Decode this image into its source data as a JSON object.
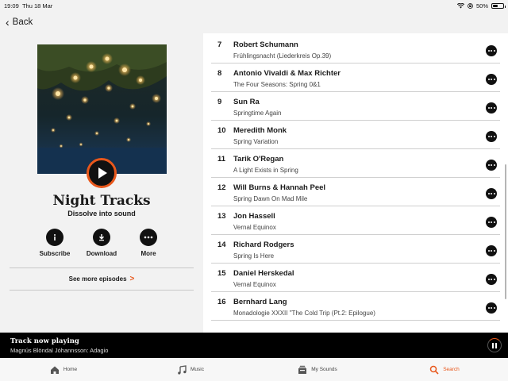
{
  "status_bar": {
    "time": "19:09",
    "date": "Thu 18 Mar",
    "battery": "50%",
    "battery_level": 0.5
  },
  "nav": {
    "back_label": "Back"
  },
  "show": {
    "title": "Night Tracks",
    "subtitle": "Dissolve into sound",
    "actions": [
      {
        "label": "Subscribe",
        "icon": "info-icon"
      },
      {
        "label": "Download",
        "icon": "download-icon"
      },
      {
        "label": "More",
        "icon": "more-icon"
      }
    ],
    "see_more": "See more episodes"
  },
  "tracks": [
    {
      "num": "7",
      "artist": "Robert Schumann",
      "title": "Frühlingsnacht (Liederkreis Op.39)"
    },
    {
      "num": "8",
      "artist": "Antonio Vivaldi & Max Richter",
      "title": "The Four Seasons: Spring 0&1"
    },
    {
      "num": "9",
      "artist": "Sun Ra",
      "title": "Springtime Again"
    },
    {
      "num": "10",
      "artist": "Meredith Monk",
      "title": "Spring Variation"
    },
    {
      "num": "11",
      "artist": "Tarik O'Regan",
      "title": "A Light Exists in Spring"
    },
    {
      "num": "12",
      "artist": "Will Burns & Hannah Peel",
      "title": "Spring Dawn On Mad Mile"
    },
    {
      "num": "13",
      "artist": "Jon Hassell",
      "title": "Vernal Equinox"
    },
    {
      "num": "14",
      "artist": "Richard Rodgers",
      "title": "Spring Is Here"
    },
    {
      "num": "15",
      "artist": "Daniel Herskedal",
      "title": "Vernal Equinox"
    },
    {
      "num": "16",
      "artist": "Bernhard Lang",
      "title": "Monadologie XXXII \"The Cold Trip (Pt.2: Epilogue)"
    }
  ],
  "now_playing": {
    "label": "Track now playing",
    "track": "Magnús Blöndal Jóhannsson: Adagio"
  },
  "tabs": [
    {
      "label": "Home",
      "icon": "home-icon",
      "active": false
    },
    {
      "label": "Music",
      "icon": "music-note-icon",
      "active": false
    },
    {
      "label": "My Sounds",
      "icon": "my-sounds-icon",
      "active": false
    },
    {
      "label": "Search",
      "icon": "search-icon",
      "active": true
    }
  ],
  "colors": {
    "accent": "#e8571b",
    "now_playing_bg": "#000000"
  }
}
